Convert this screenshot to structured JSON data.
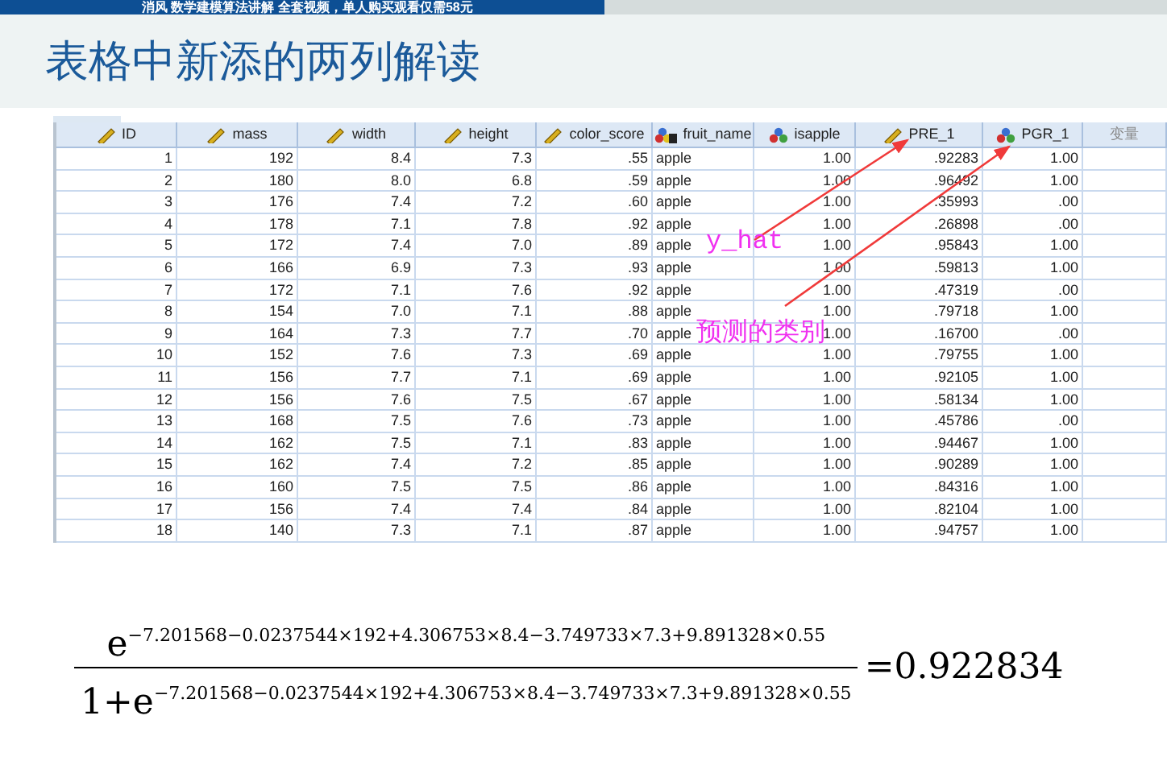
{
  "banner": {
    "text": "消风 数学建模算法讲解 全套视频，单人购买观看仅需58元"
  },
  "slide_title": "表格中新添的两列解读",
  "table": {
    "columns": [
      {
        "label": "ID",
        "kind": "scale"
      },
      {
        "label": "mass",
        "kind": "scale"
      },
      {
        "label": "width",
        "kind": "scale"
      },
      {
        "label": "height",
        "kind": "scale"
      },
      {
        "label": "color_score",
        "kind": "scale"
      },
      {
        "label": "fruit_name",
        "kind": "text"
      },
      {
        "label": "isapple",
        "kind": "nominal"
      },
      {
        "label": "PRE_1",
        "kind": "scale"
      },
      {
        "label": "PGR_1",
        "kind": "nominal"
      },
      {
        "label": "变量",
        "kind": "empty"
      }
    ],
    "rows": [
      [
        "1",
        "192",
        "8.4",
        "7.3",
        ".55",
        "apple",
        "1.00",
        ".92283",
        "1.00"
      ],
      [
        "2",
        "180",
        "8.0",
        "6.8",
        ".59",
        "apple",
        "1.00",
        ".96492",
        "1.00"
      ],
      [
        "3",
        "176",
        "7.4",
        "7.2",
        ".60",
        "apple",
        "1.00",
        ".35993",
        ".00"
      ],
      [
        "4",
        "178",
        "7.1",
        "7.8",
        ".92",
        "apple",
        "1.00",
        ".26898",
        ".00"
      ],
      [
        "5",
        "172",
        "7.4",
        "7.0",
        ".89",
        "apple",
        "1.00",
        ".95843",
        "1.00"
      ],
      [
        "6",
        "166",
        "6.9",
        "7.3",
        ".93",
        "apple",
        "1.00",
        ".59813",
        "1.00"
      ],
      [
        "7",
        "172",
        "7.1",
        "7.6",
        ".92",
        "apple",
        "1.00",
        ".47319",
        ".00"
      ],
      [
        "8",
        "154",
        "7.0",
        "7.1",
        ".88",
        "apple",
        "1.00",
        ".79718",
        "1.00"
      ],
      [
        "9",
        "164",
        "7.3",
        "7.7",
        ".70",
        "apple",
        "1.00",
        ".16700",
        ".00"
      ],
      [
        "10",
        "152",
        "7.6",
        "7.3",
        ".69",
        "apple",
        "1.00",
        ".79755",
        "1.00"
      ],
      [
        "11",
        "156",
        "7.7",
        "7.1",
        ".69",
        "apple",
        "1.00",
        ".92105",
        "1.00"
      ],
      [
        "12",
        "156",
        "7.6",
        "7.5",
        ".67",
        "apple",
        "1.00",
        ".58134",
        "1.00"
      ],
      [
        "13",
        "168",
        "7.5",
        "7.6",
        ".73",
        "apple",
        "1.00",
        ".45786",
        ".00"
      ],
      [
        "14",
        "162",
        "7.5",
        "7.1",
        ".83",
        "apple",
        "1.00",
        ".94467",
        "1.00"
      ],
      [
        "15",
        "162",
        "7.4",
        "7.2",
        ".85",
        "apple",
        "1.00",
        ".90289",
        "1.00"
      ],
      [
        "16",
        "160",
        "7.5",
        "7.5",
        ".86",
        "apple",
        "1.00",
        ".84316",
        "1.00"
      ],
      [
        "17",
        "156",
        "7.4",
        "7.4",
        ".84",
        "apple",
        "1.00",
        ".82104",
        "1.00"
      ],
      [
        "18",
        "140",
        "7.3",
        "7.1",
        ".87",
        "apple",
        "1.00",
        ".94757",
        "1.00"
      ]
    ]
  },
  "annotations": [
    {
      "text": "y_hat"
    },
    {
      "text": "预测的类别"
    }
  ],
  "formula": {
    "numerator": "e$^{−7.201568−0.0237544×192+4.306753×8.4−3.749733×7.3+9.891328×0.55}$",
    "denominator": "1+e$^{−7.201568−0.0237544×192+4.306753×8.4−3.749733×7.3+9.891328×0.55}$",
    "result": "=0.922834"
  }
}
